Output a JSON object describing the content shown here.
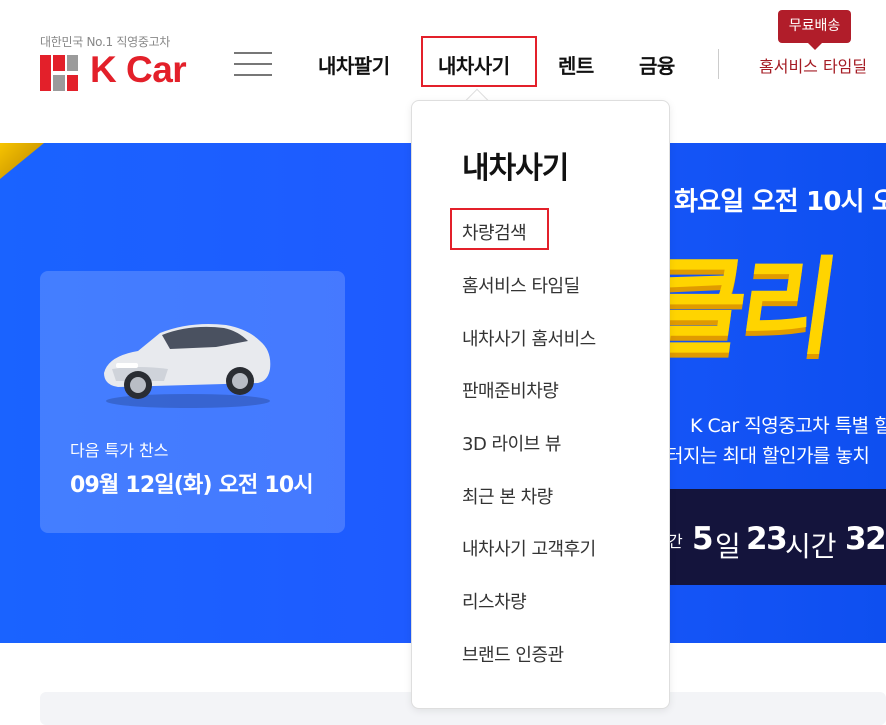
{
  "header": {
    "logo": {
      "tagline": "대한민국 No.1 직영중고차",
      "brand": "K Car"
    },
    "menu_icon": "hamburger-menu-icon",
    "nav": [
      "내차팔기",
      "내차사기",
      "렌트",
      "금융"
    ],
    "active_nav": "내차사기",
    "home_timedeal": "홈서비스 타임딜",
    "free_badge": "무료배송"
  },
  "dropdown": {
    "title": "내차사기",
    "items": [
      "차량검색",
      "홈서비스 타임딜",
      "내차사기 홈서비스",
      "판매준비차량",
      "3D 라이브 뷰",
      "최근 본 차량",
      "내차사기 고객후기",
      "리스차량",
      "브랜드 인증관"
    ],
    "highlighted_item": "차량검색"
  },
  "banner": {
    "next_deal_label": "다음 특가 찬스",
    "next_deal_date": "09월 12일(화) 오전 10시",
    "promo_date": "화요일 오전 10시 오",
    "promo_big": "클리",
    "promo_desc_1": "K Car 직영중고차 특별 할",
    "promo_desc_2": "터지는 최대 할인가를 놓치",
    "countdown": {
      "prefix": "간",
      "days": "5",
      "days_unit": "일",
      "hours": "23",
      "hours_unit": "시간",
      "minutes": "32"
    }
  },
  "colors": {
    "brand_red": "#e3202a",
    "banner_blue": "#1a63ff",
    "promo_yellow": "#ffd400",
    "badge_red": "#b11d2a"
  }
}
